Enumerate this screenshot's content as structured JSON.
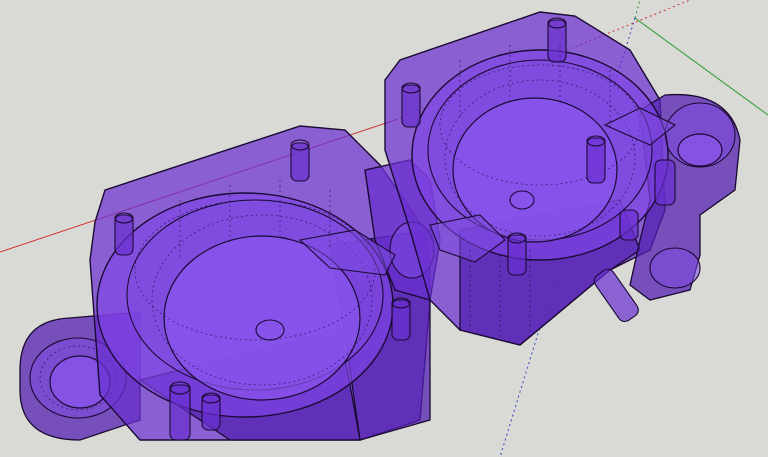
{
  "scene": {
    "background_color": "#d9d9d5",
    "model_color": "#6a2fd0",
    "axes": {
      "red_axis_color": "#cc3333",
      "green_axis_color": "#2a9a2a",
      "blue_axis_color": "#3344cc"
    },
    "objects": [
      "twin-cup-holder-model",
      "left-cup-ring",
      "right-cup-ring",
      "left-mount-ring",
      "right-mount-lug"
    ]
  }
}
